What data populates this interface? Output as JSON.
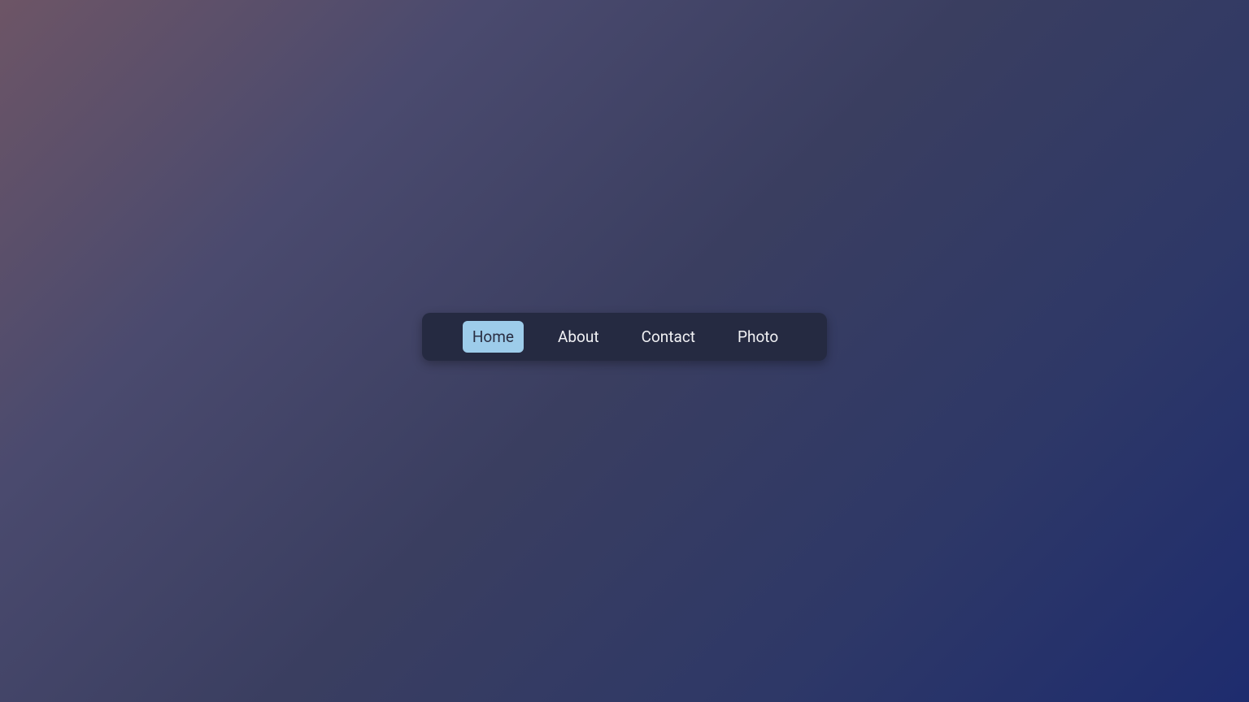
{
  "nav": {
    "items": [
      {
        "label": "Home",
        "active": true
      },
      {
        "label": "About",
        "active": false
      },
      {
        "label": "Contact",
        "active": false
      },
      {
        "label": "Photo",
        "active": false
      }
    ]
  },
  "colors": {
    "nav_bg": "#252a41",
    "nav_text": "#f1f1f4",
    "active_bg": "#9dccea",
    "active_text": "#2a2e42"
  }
}
